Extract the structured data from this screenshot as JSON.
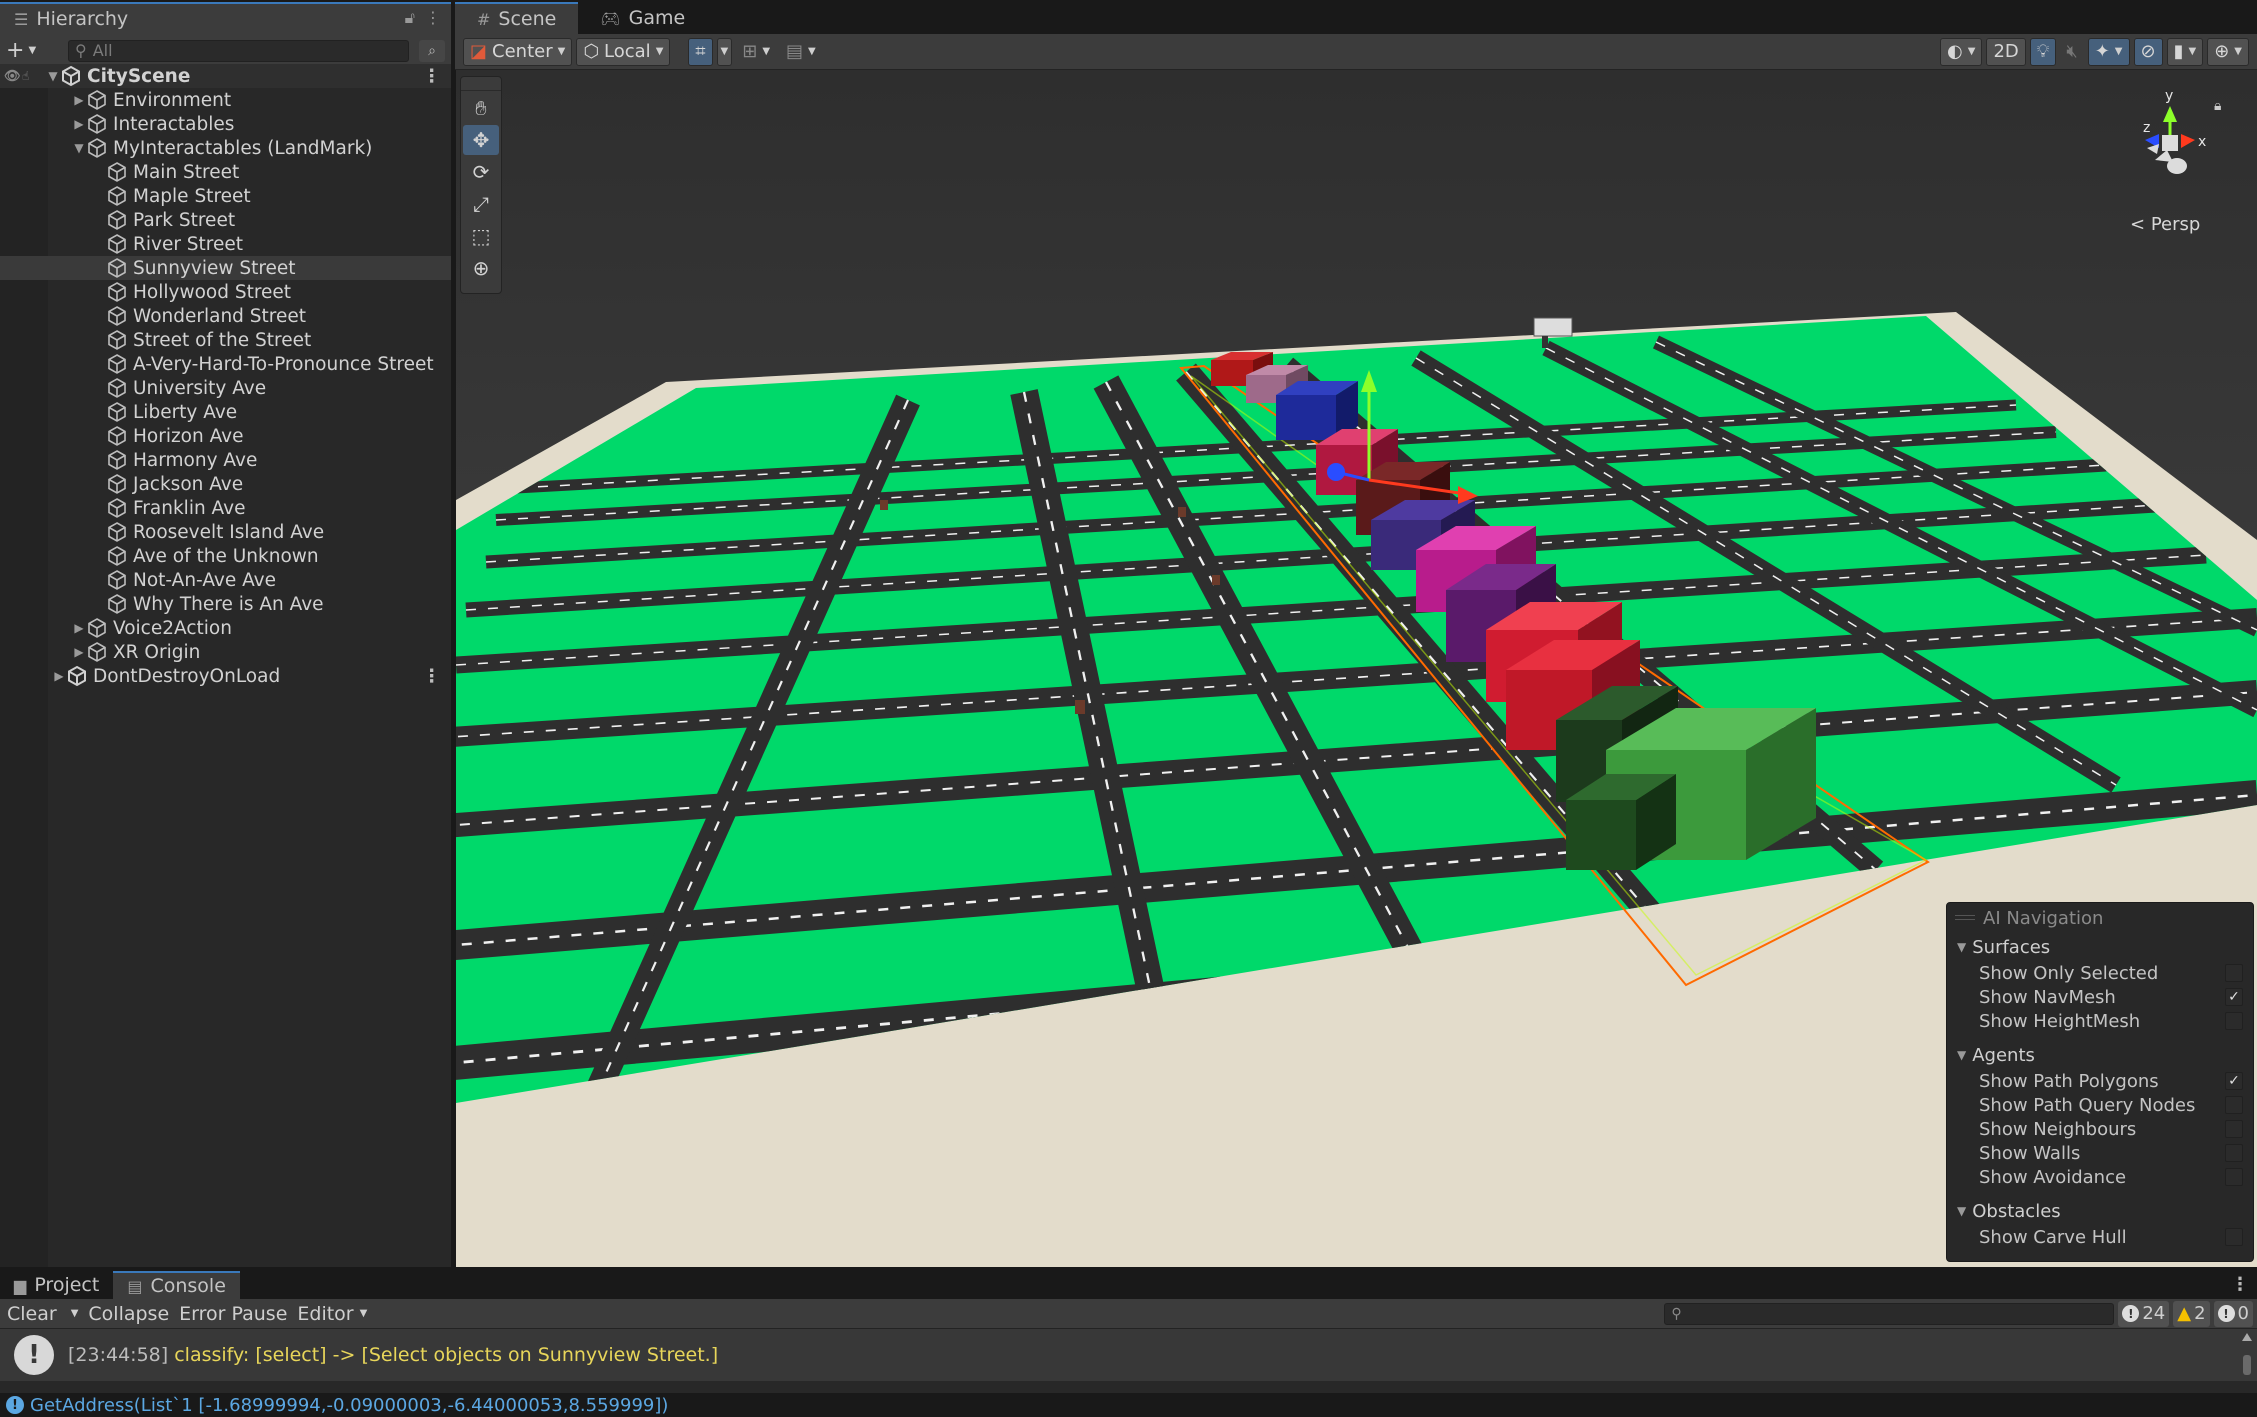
{
  "hierarchy": {
    "tab_label": "Hierarchy",
    "search_placeholder": "All",
    "scene_name": "CityScene",
    "items": [
      {
        "label": "Environment",
        "depth": 1,
        "arrow": "▶"
      },
      {
        "label": "Interactables",
        "depth": 1,
        "arrow": "▶"
      },
      {
        "label": "MyInteractables (LandMark)",
        "depth": 1,
        "arrow": "▼"
      },
      {
        "label": "Main Street",
        "depth": 2
      },
      {
        "label": "Maple Street",
        "depth": 2
      },
      {
        "label": "Park Street",
        "depth": 2
      },
      {
        "label": "River Street",
        "depth": 2
      },
      {
        "label": "Sunnyview Street",
        "depth": 2,
        "selected": true
      },
      {
        "label": "Hollywood Street",
        "depth": 2
      },
      {
        "label": "Wonderland Street",
        "depth": 2
      },
      {
        "label": "Street of the Street",
        "depth": 2
      },
      {
        "label": "A-Very-Hard-To-Pronounce Street",
        "depth": 2
      },
      {
        "label": "University Ave",
        "depth": 2
      },
      {
        "label": "Liberty Ave",
        "depth": 2
      },
      {
        "label": "Horizon Ave",
        "depth": 2
      },
      {
        "label": "Harmony Ave",
        "depth": 2
      },
      {
        "label": "Jackson Ave",
        "depth": 2
      },
      {
        "label": "Franklin Ave",
        "depth": 2
      },
      {
        "label": "Roosevelt Island Ave",
        "depth": 2
      },
      {
        "label": "Ave of the Unknown",
        "depth": 2
      },
      {
        "label": "Not-An-Ave Ave",
        "depth": 2
      },
      {
        "label": "Why There is An Ave",
        "depth": 2
      },
      {
        "label": "Voice2Action",
        "depth": 1,
        "arrow": "▶"
      },
      {
        "label": "XR Origin",
        "depth": 1,
        "arrow": "▶"
      }
    ],
    "dont_destroy": "DontDestroyOnLoad"
  },
  "scene_tabs": {
    "scene": "Scene",
    "game": "Game"
  },
  "scene_toolbar": {
    "pivot": "Center",
    "space": "Local",
    "mode_2d": "2D"
  },
  "view": {
    "projection": "Persp",
    "axes": {
      "x": "x",
      "y": "y",
      "z": "z"
    }
  },
  "ai_navigation": {
    "title": "AI Navigation",
    "sections": [
      {
        "name": "Surfaces",
        "items": [
          {
            "label": "Show Only Selected",
            "checked": false
          },
          {
            "label": "Show NavMesh",
            "checked": true
          },
          {
            "label": "Show HeightMesh",
            "checked": false
          }
        ]
      },
      {
        "name": "Agents",
        "items": [
          {
            "label": "Show Path Polygons",
            "checked": true
          },
          {
            "label": "Show Path Query Nodes",
            "checked": false
          },
          {
            "label": "Show Neighbours",
            "checked": false
          },
          {
            "label": "Show Walls",
            "checked": false
          },
          {
            "label": "Show Avoidance",
            "checked": false
          }
        ]
      },
      {
        "name": "Obstacles",
        "items": [
          {
            "label": "Show Carve Hull",
            "checked": false
          }
        ]
      }
    ]
  },
  "console": {
    "tabs": {
      "project": "Project",
      "console": "Console"
    },
    "buttons": {
      "clear": "Clear",
      "collapse": "Collapse",
      "error_pause": "Error Pause",
      "editor": "Editor"
    },
    "counts": {
      "info": "24",
      "warn": "2",
      "error": "0"
    },
    "log_time": "[23:44:58]",
    "log_message": "classify: [select] -> [Select objects on Sunnyview Street.]",
    "status": "GetAddress(List`1 [-1.68999994,-0.09000003,-6.44000053,8.559999])"
  },
  "colors": {
    "ground": "#00d96a",
    "plane": "#e6e0cf",
    "road": "#2e2e2e",
    "selection": "#3a79bb"
  }
}
